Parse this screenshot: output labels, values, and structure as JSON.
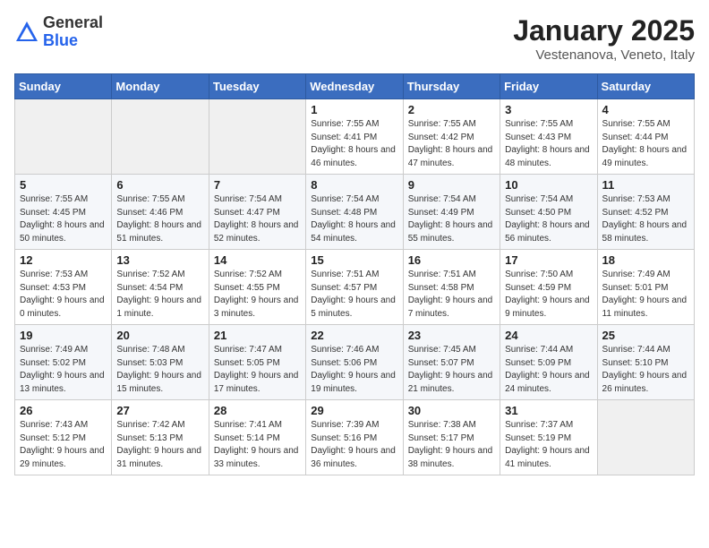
{
  "header": {
    "logo_general": "General",
    "logo_blue": "Blue",
    "month": "January 2025",
    "location": "Vestenanova, Veneto, Italy"
  },
  "weekdays": [
    "Sunday",
    "Monday",
    "Tuesday",
    "Wednesday",
    "Thursday",
    "Friday",
    "Saturday"
  ],
  "weeks": [
    [
      {
        "day": "",
        "info": ""
      },
      {
        "day": "",
        "info": ""
      },
      {
        "day": "",
        "info": ""
      },
      {
        "day": "1",
        "info": "Sunrise: 7:55 AM\nSunset: 4:41 PM\nDaylight: 8 hours and 46 minutes."
      },
      {
        "day": "2",
        "info": "Sunrise: 7:55 AM\nSunset: 4:42 PM\nDaylight: 8 hours and 47 minutes."
      },
      {
        "day": "3",
        "info": "Sunrise: 7:55 AM\nSunset: 4:43 PM\nDaylight: 8 hours and 48 minutes."
      },
      {
        "day": "4",
        "info": "Sunrise: 7:55 AM\nSunset: 4:44 PM\nDaylight: 8 hours and 49 minutes."
      }
    ],
    [
      {
        "day": "5",
        "info": "Sunrise: 7:55 AM\nSunset: 4:45 PM\nDaylight: 8 hours and 50 minutes."
      },
      {
        "day": "6",
        "info": "Sunrise: 7:55 AM\nSunset: 4:46 PM\nDaylight: 8 hours and 51 minutes."
      },
      {
        "day": "7",
        "info": "Sunrise: 7:54 AM\nSunset: 4:47 PM\nDaylight: 8 hours and 52 minutes."
      },
      {
        "day": "8",
        "info": "Sunrise: 7:54 AM\nSunset: 4:48 PM\nDaylight: 8 hours and 54 minutes."
      },
      {
        "day": "9",
        "info": "Sunrise: 7:54 AM\nSunset: 4:49 PM\nDaylight: 8 hours and 55 minutes."
      },
      {
        "day": "10",
        "info": "Sunrise: 7:54 AM\nSunset: 4:50 PM\nDaylight: 8 hours and 56 minutes."
      },
      {
        "day": "11",
        "info": "Sunrise: 7:53 AM\nSunset: 4:52 PM\nDaylight: 8 hours and 58 minutes."
      }
    ],
    [
      {
        "day": "12",
        "info": "Sunrise: 7:53 AM\nSunset: 4:53 PM\nDaylight: 9 hours and 0 minutes."
      },
      {
        "day": "13",
        "info": "Sunrise: 7:52 AM\nSunset: 4:54 PM\nDaylight: 9 hours and 1 minute."
      },
      {
        "day": "14",
        "info": "Sunrise: 7:52 AM\nSunset: 4:55 PM\nDaylight: 9 hours and 3 minutes."
      },
      {
        "day": "15",
        "info": "Sunrise: 7:51 AM\nSunset: 4:57 PM\nDaylight: 9 hours and 5 minutes."
      },
      {
        "day": "16",
        "info": "Sunrise: 7:51 AM\nSunset: 4:58 PM\nDaylight: 9 hours and 7 minutes."
      },
      {
        "day": "17",
        "info": "Sunrise: 7:50 AM\nSunset: 4:59 PM\nDaylight: 9 hours and 9 minutes."
      },
      {
        "day": "18",
        "info": "Sunrise: 7:49 AM\nSunset: 5:01 PM\nDaylight: 9 hours and 11 minutes."
      }
    ],
    [
      {
        "day": "19",
        "info": "Sunrise: 7:49 AM\nSunset: 5:02 PM\nDaylight: 9 hours and 13 minutes."
      },
      {
        "day": "20",
        "info": "Sunrise: 7:48 AM\nSunset: 5:03 PM\nDaylight: 9 hours and 15 minutes."
      },
      {
        "day": "21",
        "info": "Sunrise: 7:47 AM\nSunset: 5:05 PM\nDaylight: 9 hours and 17 minutes."
      },
      {
        "day": "22",
        "info": "Sunrise: 7:46 AM\nSunset: 5:06 PM\nDaylight: 9 hours and 19 minutes."
      },
      {
        "day": "23",
        "info": "Sunrise: 7:45 AM\nSunset: 5:07 PM\nDaylight: 9 hours and 21 minutes."
      },
      {
        "day": "24",
        "info": "Sunrise: 7:44 AM\nSunset: 5:09 PM\nDaylight: 9 hours and 24 minutes."
      },
      {
        "day": "25",
        "info": "Sunrise: 7:44 AM\nSunset: 5:10 PM\nDaylight: 9 hours and 26 minutes."
      }
    ],
    [
      {
        "day": "26",
        "info": "Sunrise: 7:43 AM\nSunset: 5:12 PM\nDaylight: 9 hours and 29 minutes."
      },
      {
        "day": "27",
        "info": "Sunrise: 7:42 AM\nSunset: 5:13 PM\nDaylight: 9 hours and 31 minutes."
      },
      {
        "day": "28",
        "info": "Sunrise: 7:41 AM\nSunset: 5:14 PM\nDaylight: 9 hours and 33 minutes."
      },
      {
        "day": "29",
        "info": "Sunrise: 7:39 AM\nSunset: 5:16 PM\nDaylight: 9 hours and 36 minutes."
      },
      {
        "day": "30",
        "info": "Sunrise: 7:38 AM\nSunset: 5:17 PM\nDaylight: 9 hours and 38 minutes."
      },
      {
        "day": "31",
        "info": "Sunrise: 7:37 AM\nSunset: 5:19 PM\nDaylight: 9 hours and 41 minutes."
      },
      {
        "day": "",
        "info": ""
      }
    ]
  ]
}
